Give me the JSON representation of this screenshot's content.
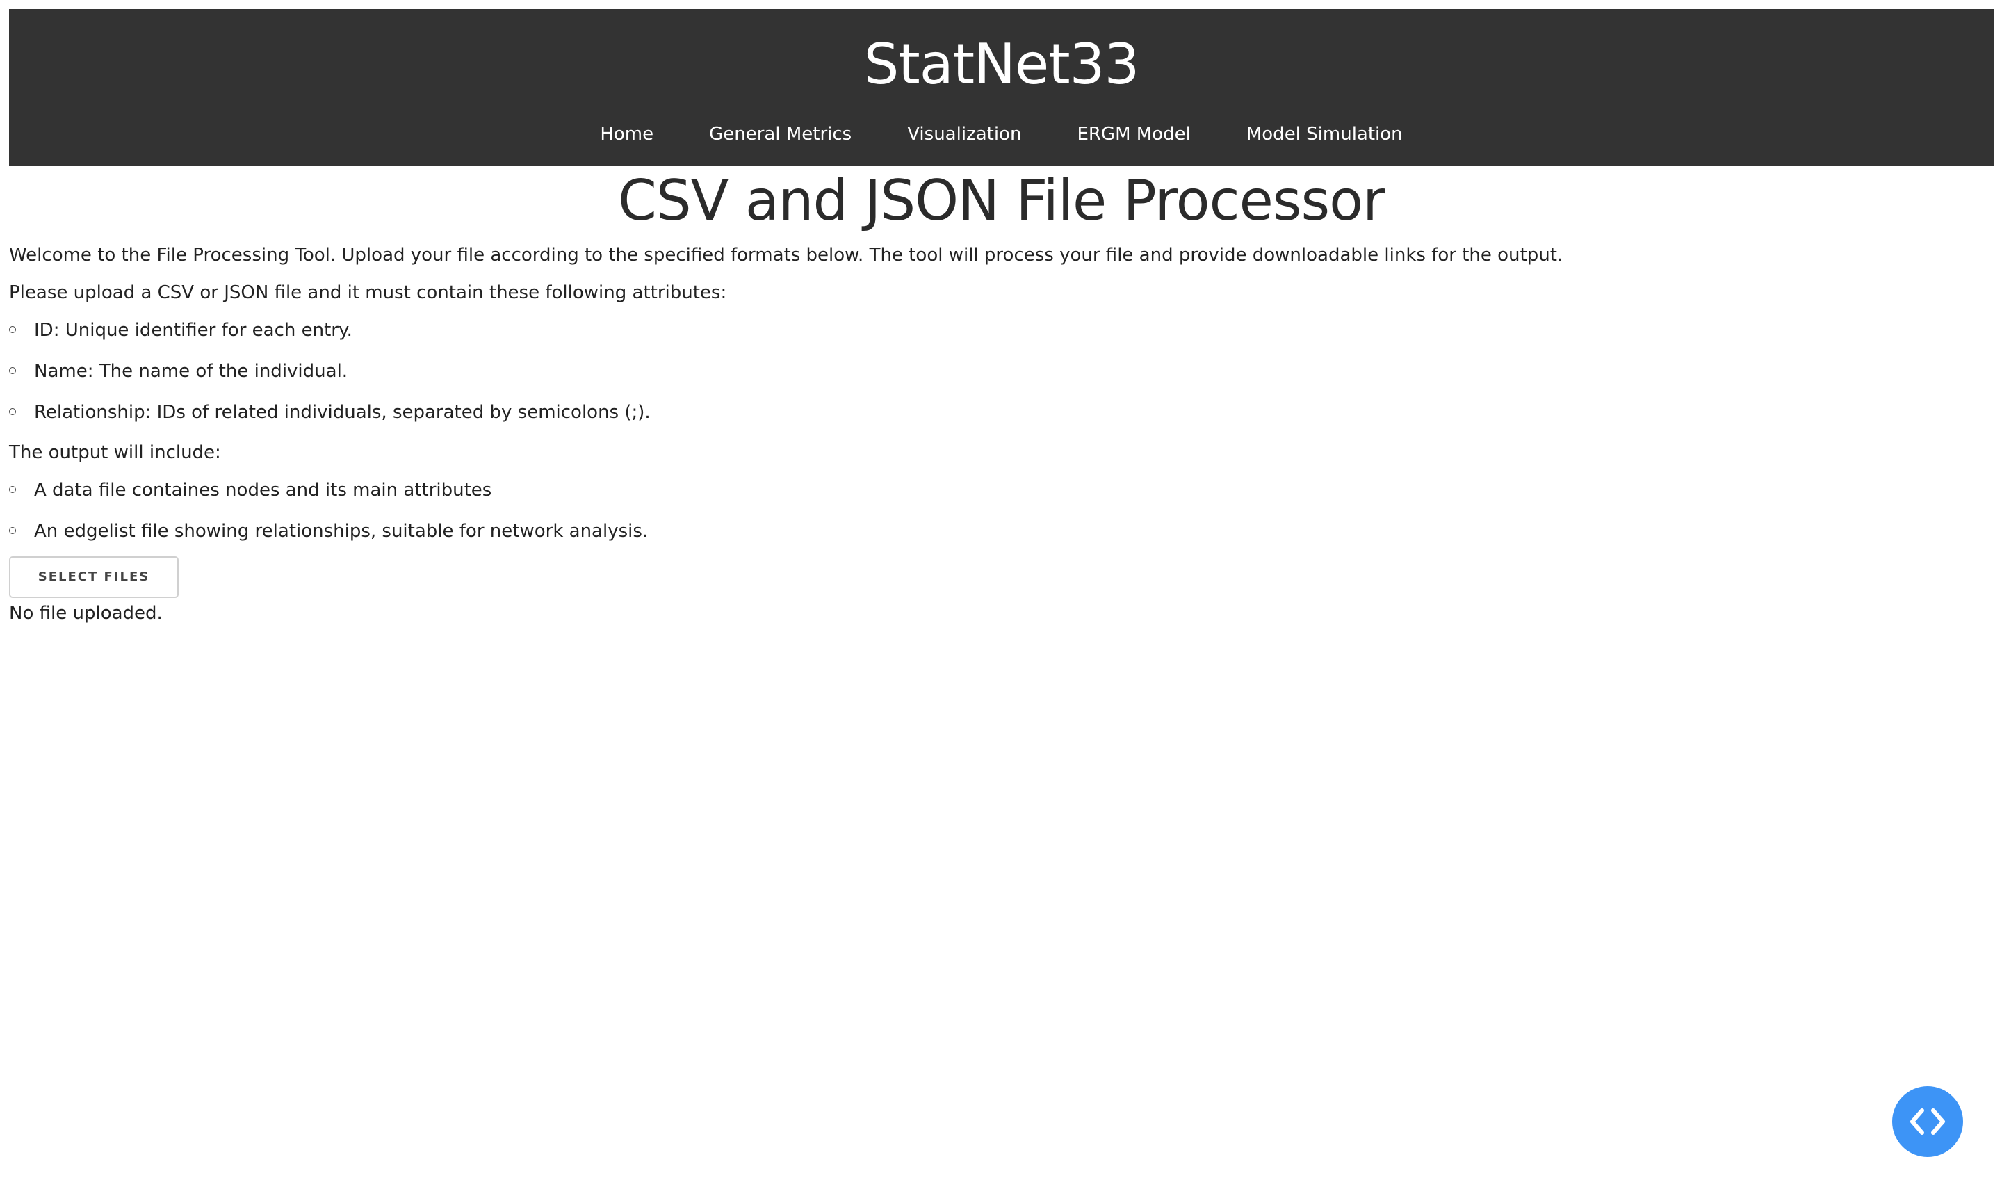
{
  "header": {
    "site_title": "StatNet33",
    "nav": [
      {
        "label": "Home"
      },
      {
        "label": "General Metrics"
      },
      {
        "label": "Visualization"
      },
      {
        "label": "ERGM Model"
      },
      {
        "label": "Model Simulation"
      }
    ]
  },
  "main": {
    "title": "CSV and JSON File Processor",
    "intro": "Welcome to the File Processing Tool. Upload your file according to the specified formats below. The tool will process your file and provide downloadable links for the output.",
    "requirements_heading": "Please upload a CSV or JSON file and it must contain these following attributes:",
    "requirements": [
      "ID: Unique identifier for each entry.",
      "Name: The name of the individual.",
      "Relationship: IDs of related individuals, separated by semicolons (;)."
    ],
    "output_heading": "The output will include:",
    "outputs": [
      "A data file containes nodes and its main attributes",
      "An edgelist file showing relationships, suitable for network analysis."
    ],
    "select_button": "SELECT FILES",
    "status": "No file uploaded."
  },
  "fab": {
    "icon": "code-icon",
    "color": "#3d94f6"
  },
  "colors": {
    "header_bg": "#333333",
    "accent": "#3d94f6"
  }
}
